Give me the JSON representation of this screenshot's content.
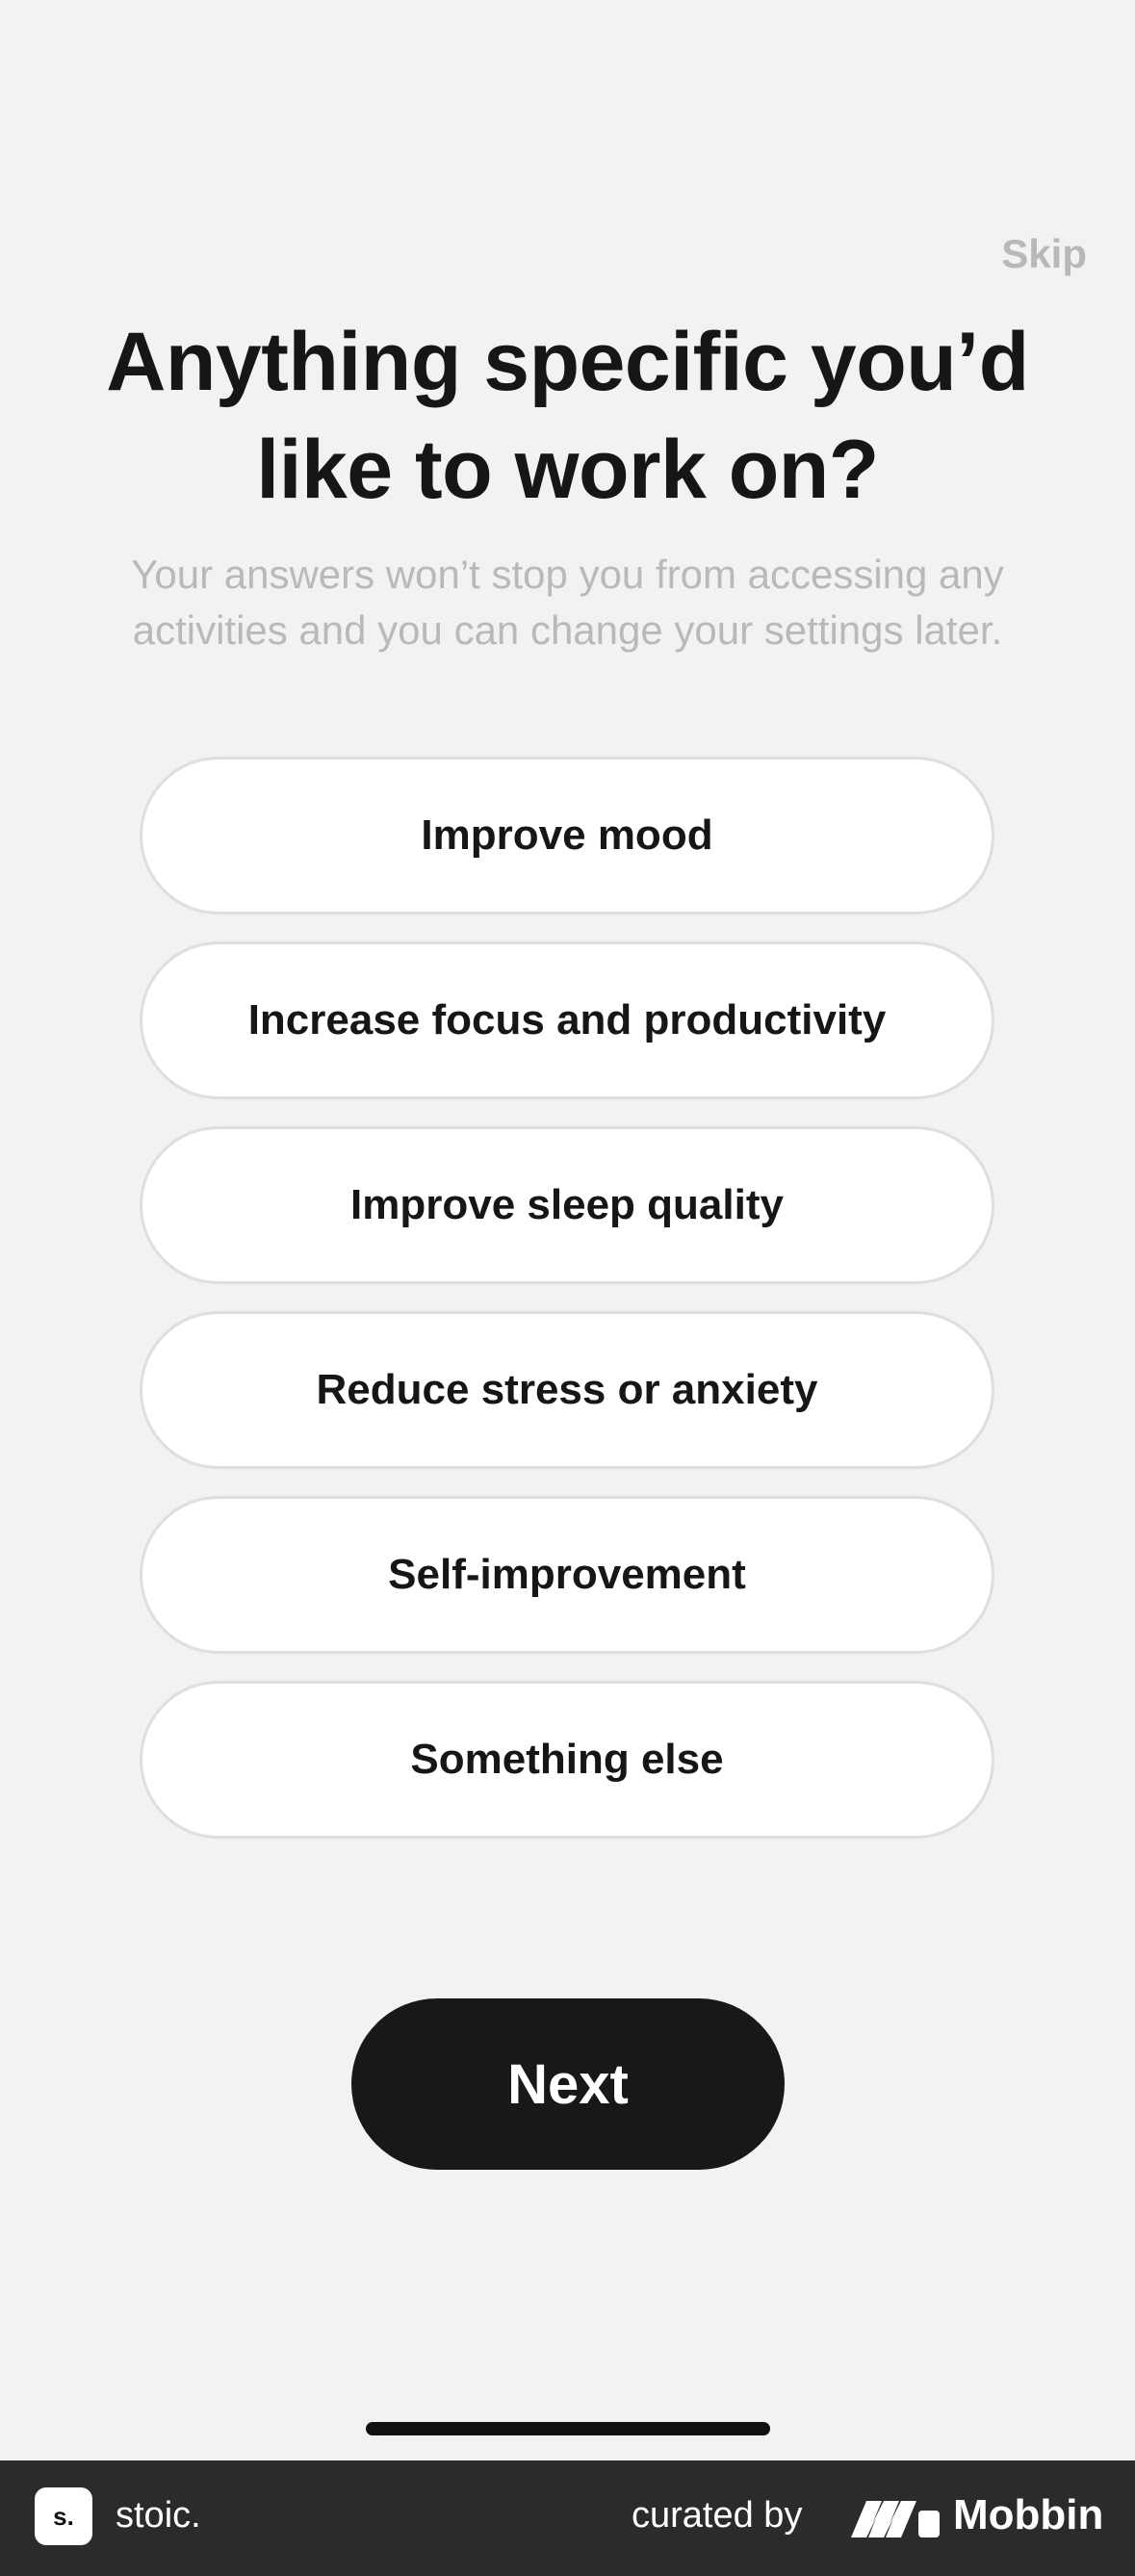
{
  "header": {
    "skip_label": "Skip"
  },
  "title": {
    "line1": "Anything specific you’d",
    "line2": "like to work on?"
  },
  "subtitle": {
    "line1": "Your answers won’t stop you from accessing any",
    "line2": "activities and you can change your settings later."
  },
  "options": [
    {
      "label": "Improve mood"
    },
    {
      "label": "Increase focus and productivity"
    },
    {
      "label": "Improve sleep quality"
    },
    {
      "label": "Reduce stress or anxiety"
    },
    {
      "label": "Self-improvement"
    },
    {
      "label": "Something else"
    }
  ],
  "next_label": "Next",
  "footer": {
    "app_logo_text": "s.",
    "app_name": "stoic.",
    "curated_by": "curated by",
    "brand": "Mobbin"
  },
  "colors": {
    "background": "#f2f2f2",
    "button_dark": "#181818",
    "footer": "#2b2b2b",
    "muted_text": "#b9b9b9"
  }
}
